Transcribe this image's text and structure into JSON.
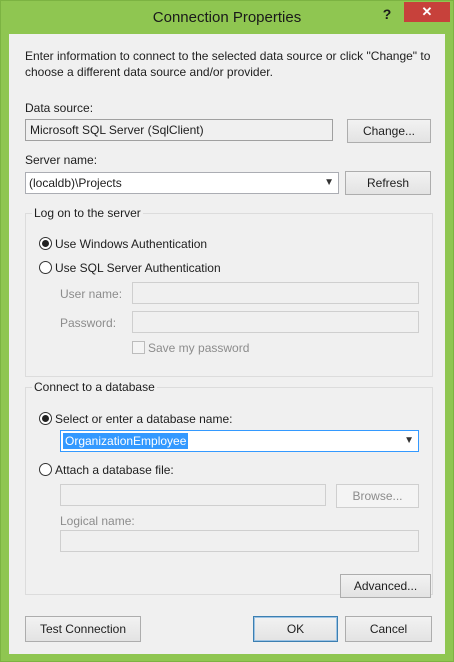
{
  "window": {
    "title": "Connection Properties",
    "help": "?",
    "close": "✕"
  },
  "description": "Enter information to connect to the selected data source or click \"Change\" to choose a different data source and/or provider.",
  "data_source": {
    "label": "Data source:",
    "value": "Microsoft SQL Server (SqlClient)",
    "change_button": "Change..."
  },
  "server": {
    "label": "Server name:",
    "value": "(localdb)\\Projects",
    "refresh_button": "Refresh"
  },
  "logon": {
    "title": "Log on to the server",
    "windows_auth": "Use Windows Authentication",
    "sql_auth": "Use SQL Server Authentication",
    "user_name_label": "User name:",
    "password_label": "Password:",
    "save_password": "Save my password",
    "selected": "windows"
  },
  "database": {
    "title": "Connect to a database",
    "select_option": "Select or enter a database name:",
    "selected_db": "OrganizationEmployee",
    "attach_option": "Attach a database file:",
    "browse_button": "Browse...",
    "logical_name_label": "Logical name:",
    "selected": "select"
  },
  "buttons": {
    "advanced": "Advanced...",
    "test_connection": "Test Connection",
    "ok": "OK",
    "cancel": "Cancel"
  }
}
